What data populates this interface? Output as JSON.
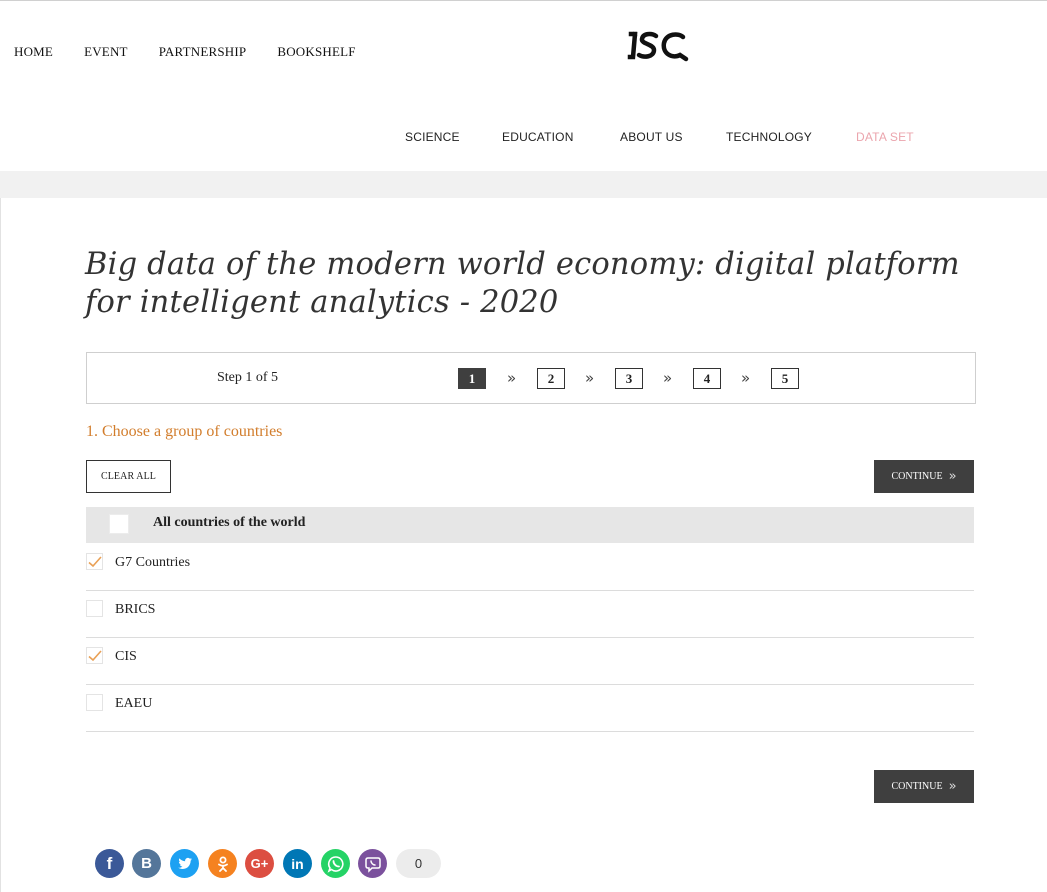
{
  "header": {
    "top_nav": [
      "HOME",
      "EVENT",
      "PARTNERSHIP",
      "BOOKSHELF"
    ],
    "logo_text": "ISC",
    "secondary_nav": [
      "SCIENCE",
      "EDUCATION",
      "ABOUT US",
      "TECHNOLOGY",
      "DATA SET"
    ],
    "active_item": "DATA SET"
  },
  "page": {
    "title": "Big data of the modern world economy: digital platform for intelligent analytics - 2020"
  },
  "steps": {
    "label": "Step 1 of 5",
    "numbers": [
      "1",
      "2",
      "3",
      "4",
      "5"
    ],
    "current": "1",
    "separator": "»"
  },
  "section": {
    "title": "1. Choose a group of countries",
    "clear_all": "CLEAR ALL",
    "continue": "CONTINUE",
    "all_label": "All countries of the world",
    "all_checked": false,
    "groups": [
      {
        "label": "G7 Countries",
        "checked": true
      },
      {
        "label": "BRICS",
        "checked": false
      },
      {
        "label": "CIS",
        "checked": true
      },
      {
        "label": "EAEU",
        "checked": false
      }
    ]
  },
  "social": {
    "icons": [
      "facebook-icon",
      "vk-icon",
      "twitter-icon",
      "odnoklassniki-icon",
      "google-plus-icon",
      "linkedin-icon",
      "whatsapp-icon",
      "viber-icon"
    ],
    "share_count": "0"
  },
  "colors": {
    "accent_orange": "#d27d2c",
    "active_nav_pink": "#eba5ad",
    "dark_button": "#3f3f3f",
    "facebook": "#3b5998",
    "vk": "#54769a",
    "twitter": "#1da1f2",
    "odnoklassniki": "#f58220",
    "google_plus": "#dc4e41",
    "linkedin": "#0077b5",
    "whatsapp": "#25d366",
    "viber": "#7b519d"
  }
}
